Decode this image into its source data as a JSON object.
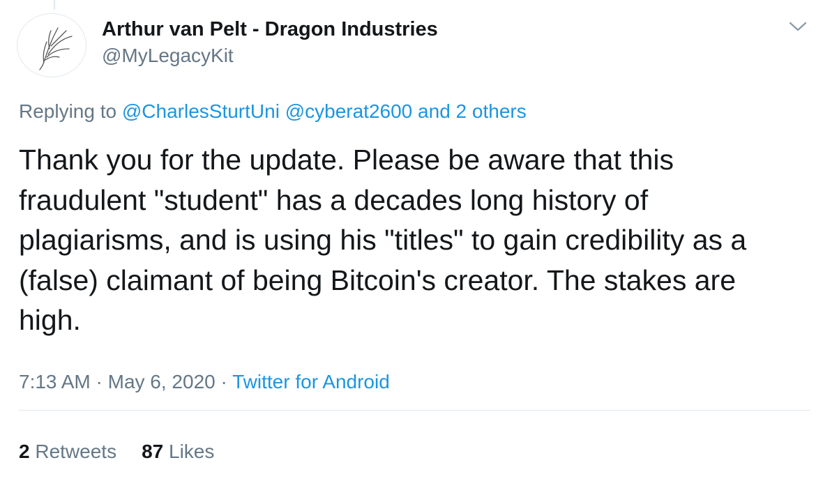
{
  "author": {
    "display_name": "Arthur van Pelt - Dragon Industries",
    "handle": "@MyLegacyKit"
  },
  "menu_icon": "chevron-down-icon",
  "reply": {
    "prefix": "Replying to ",
    "mentions": [
      "@CharlesSturtUni",
      "@cyberat2600"
    ],
    "others": "and 2 others"
  },
  "tweet": {
    "text": "Thank you for the update. Please be aware that this\nfraudulent \"student\" has a decades long history of\nplagiarisms, and is using his \"titles\" to gain credibility as a\n(false) claimant of being Bitcoin's creator. The stakes are\nhigh.",
    "time": "7:13 AM",
    "date": "May 6, 2020",
    "source": "Twitter for Android",
    "separator": " · "
  },
  "stats": {
    "retweets_count": "2",
    "retweets_label": "Retweets",
    "likes_count": "87",
    "likes_label": "Likes"
  },
  "colors": {
    "text": "#14171a",
    "secondary": "#657786",
    "link": "#1b95e0",
    "border": "#e1e8ed"
  }
}
